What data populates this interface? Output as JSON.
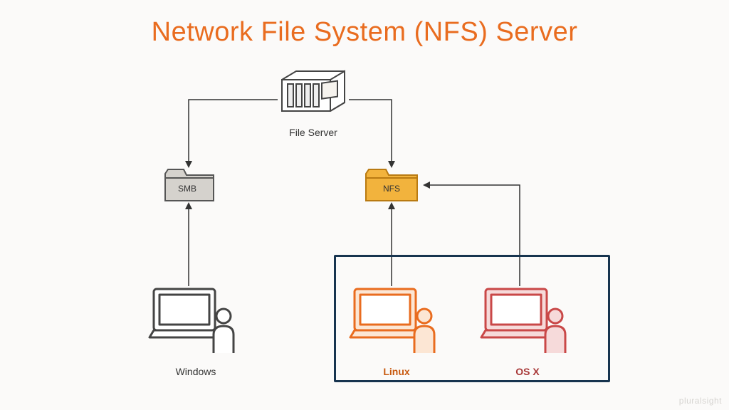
{
  "title": "Network File System (NFS) Server",
  "nodes": {
    "server": {
      "label": "File Server"
    },
    "smb": {
      "label": "SMB"
    },
    "nfs": {
      "label": "NFS"
    },
    "windows": {
      "label": "Windows"
    },
    "linux": {
      "label": "Linux"
    },
    "osx": {
      "label": "OS X"
    }
  },
  "edges": [
    {
      "from": "server",
      "to": "smb"
    },
    {
      "from": "server",
      "to": "nfs"
    },
    {
      "from": "windows",
      "to": "smb"
    },
    {
      "from": "linux",
      "to": "nfs"
    },
    {
      "from": "osx",
      "to": "nfs"
    }
  ],
  "highlight_group": [
    "linux",
    "osx"
  ],
  "watermark": "pluralsight",
  "colors": {
    "title": "#e96c1f",
    "smb_fill": "#dedcd9",
    "nfs_fill": "#f2b33d",
    "linux": "#e96c1f",
    "osx": "#c94848",
    "box": "#17344f"
  }
}
